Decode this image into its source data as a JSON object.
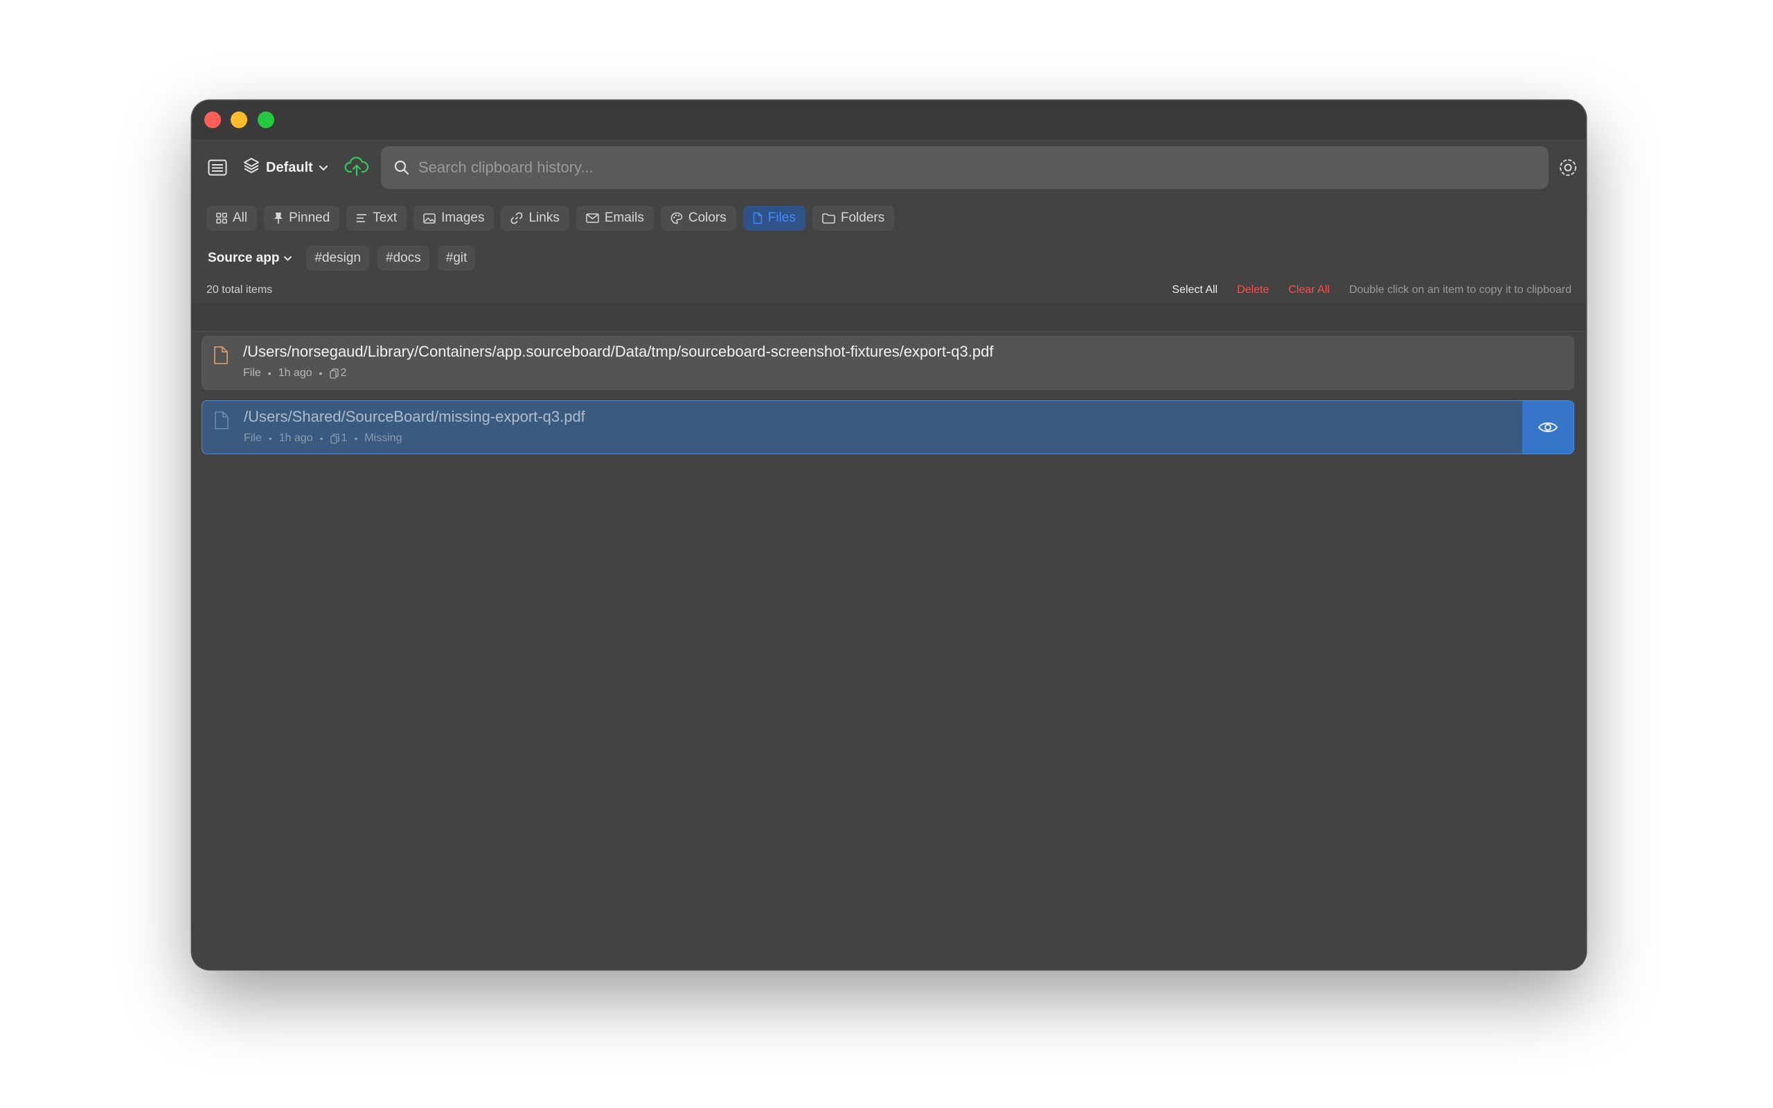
{
  "window": {
    "profile": "Default"
  },
  "search": {
    "placeholder": "Search clipboard history..."
  },
  "filters": [
    {
      "label": "All",
      "icon": "grid-icon"
    },
    {
      "label": "Pinned",
      "icon": "pin-icon"
    },
    {
      "label": "Text",
      "icon": "text-lines-icon"
    },
    {
      "label": "Images",
      "icon": "image-icon"
    },
    {
      "label": "Links",
      "icon": "link-icon"
    },
    {
      "label": "Emails",
      "icon": "envelope-icon"
    },
    {
      "label": "Colors",
      "icon": "palette-icon"
    },
    {
      "label": "Files",
      "icon": "file-icon",
      "active": true
    },
    {
      "label": "Folders",
      "icon": "folder-icon"
    }
  ],
  "tags": {
    "source_label": "Source app",
    "items": [
      "#design",
      "#docs",
      "#git"
    ]
  },
  "status": {
    "total": "20 total items",
    "select_all": "Select All",
    "delete": "Delete",
    "clear_all": "Clear All",
    "hint": "Double click on an item to copy it to clipboard"
  },
  "items": [
    {
      "path": "/Users/norsegaud/Library/Containers/app.sourceboard/Data/tmp/sourceboard-screenshot-fixtures/export-q3.pdf",
      "type": "File",
      "time": "1h ago",
      "count": "2"
    },
    {
      "path": "/Users/Shared/SourceBoard/missing-export-q3.pdf",
      "type": "File",
      "time": "1h ago",
      "count": "1",
      "state": "Missing"
    }
  ],
  "colors": {
    "accent": "#3f8cff",
    "danger": "#ff4d4d",
    "selected_row": "#3b5a80",
    "cloud": "#34c759"
  }
}
